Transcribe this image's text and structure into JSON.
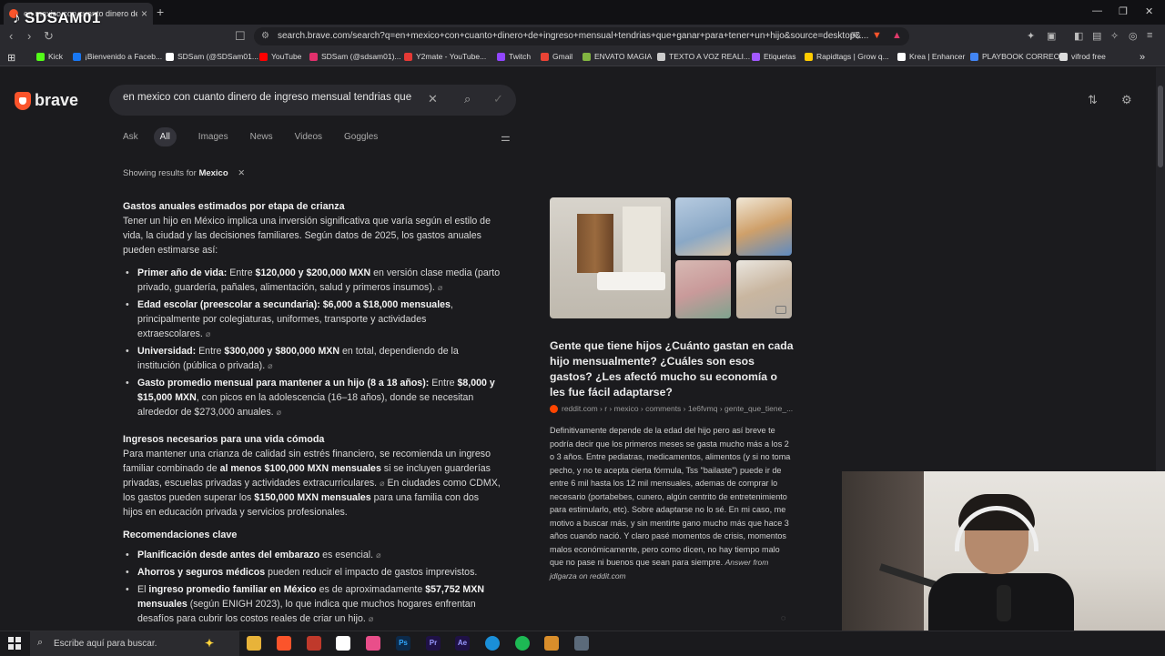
{
  "overlay": {
    "watermark": "SDSAM01"
  },
  "browser": {
    "tab_title": "en mexico con cuanto dinero de...",
    "url": "search.brave.com/search?q=en+mexico+con+cuanto+dinero+de+ingreso+mensual+tendrias+que+ganar+para+tener+un+hijo&source=desktop&...",
    "bookmarks": [
      {
        "label": "Kick",
        "color": "#53fc18"
      },
      {
        "label": "¡Bienvenido a Faceb...",
        "color": "#1877f2"
      },
      {
        "label": "SDSam (@SDSam01...",
        "color": "#ffffff"
      },
      {
        "label": "YouTube",
        "color": "#ff0000"
      },
      {
        "label": "SDSam (@sdsam01)...",
        "color": "#e1306c"
      },
      {
        "label": "Y2mate - YouTube...",
        "color": "#e53935"
      },
      {
        "label": "Twitch",
        "color": "#9146ff"
      },
      {
        "label": "Gmail",
        "color": "#ea4335"
      },
      {
        "label": "ENVATO MAGIA",
        "color": "#82b541"
      },
      {
        "label": "TEXTO A VOZ REALI...",
        "color": "#cccccc"
      },
      {
        "label": "Etiquetas",
        "color": "#a259ff"
      },
      {
        "label": "Rapidtags | Grow q...",
        "color": "#ffcc00"
      },
      {
        "label": "Krea | Enhancer",
        "color": "#ffffff"
      },
      {
        "label": "PLAYBOOK CORREO",
        "color": "#4285f4"
      },
      {
        "label": "vifrod free",
        "color": "#dddddd"
      }
    ]
  },
  "search": {
    "brand": "brave",
    "query": "en mexico con cuanto dinero de ingreso mensual tendrias que ganar para tener un hijo",
    "tabs": [
      "Ask",
      "All",
      "Images",
      "News",
      "Videos",
      "Goggles"
    ],
    "active_tab": "All",
    "showing_prefix": "Showing results for",
    "showing_region": "Mexico"
  },
  "answer": {
    "s1_title": "Gastos anuales estimados por etapa de crianza",
    "s1_intro": "Tener un hijo en México implica una inversión significativa que varía según el estilo de vida, la ciudad y las decisiones familiares. Según datos de 2025, los gastos anuales pueden estimarse así:",
    "s1_items": [
      {
        "bold": "Primer año de vida:",
        "pre": " Entre ",
        "amount": "$120,000 y $200,000 MXN",
        "rest": " en versión clase media (parto privado, guardería, pañales, alimentación, salud y primeros insumos)."
      },
      {
        "bold": "Edad escolar (preescolar a secundaria):",
        "pre": " ",
        "amount": "$6,000 a $18,000 mensuales",
        "rest": ", principalmente por colegiaturas, uniformes, transporte y actividades extraescolares."
      },
      {
        "bold": "Universidad:",
        "pre": " Entre ",
        "amount": "$300,000 y $800,000 MXN",
        "rest": " en total, dependiendo de la institución (pública o privada)."
      },
      {
        "bold": "Gasto promedio mensual para mantener a un hijo (8 a 18 años):",
        "pre": " Entre ",
        "amount": "$8,000 y $15,000 MXN",
        "rest": ", con picos en la adolescencia (16–18 años), donde se necesitan alrededor de $273,000 anuales."
      }
    ],
    "s2_title": "Ingresos necesarios para una vida cómoda",
    "s2_p1": "Para mantener una crianza de calidad sin estrés financiero, se recomienda un ingreso familiar combinado de ",
    "s2_b1": "al menos $100,000 MXN mensuales",
    "s2_p2": " si se incluyen guarderías privadas, escuelas privadas y actividades extracurriculares.",
    "s2_p3": " En ciudades como CDMX, los gastos pueden superar los ",
    "s2_b2": "$150,000 MXN mensuales",
    "s2_p4": " para una familia con dos hijos en educación privada y servicios profesionales.",
    "s3_title": "Recomendaciones clave",
    "s3_items": [
      {
        "bold": "Planificación desde antes del embarazo",
        "rest": " es esencial."
      },
      {
        "bold": "Ahorros y seguros médicos",
        "rest": " pueden reducir el impacto de gastos imprevistos."
      },
      {
        "pre": "El ",
        "bold": "ingreso promedio familiar en México",
        "mid": " es de aproximadamente ",
        "bold2": "$57,752 MXN mensuales",
        "rest": " (según ENIGH 2023), lo que indica que muchos hogares enfrentan desafíos para cubrir los costos reales de criar un hijo."
      }
    ]
  },
  "result": {
    "title": "Gente que tiene hijos ¿Cuánto gastan en cada hijo mensualmente? ¿Cuáles son esos gastos? ¿Les afectó mucho su economía o les fue fácil adaptarse?",
    "source": "reddit.com › r › mexico › comments › 1e6fvmq › gente_que_tiene_...",
    "body": "Definitivamente depende de la edad del hijo pero así breve te podría decir que los primeros meses se gasta mucho más a los 2 o 3 años. Entre pediatras, medicamentos, alimentos (y si no toma pecho, y no te acepta cierta fórmula, Tss \"bailaste\") puede ir de entre 6 mil hasta los 12 mil mensuales, ademas de comprar lo necesario (portabebes, cunero, algún centrito de entretenimiento para estimularlo, etc). Sobre adaptarse no lo sé. En mi caso, me motivo a buscar más, y sin mentirte gano mucho más que hace 3 años cuando nació. Y claro pasé momentos de crisis, momentos malos económicamente, pero como dicen, no hay tiempo malo que no pase ni buenos que sean para siempre.",
    "attribution": "Answer from jdlgarza on reddit.com"
  },
  "taskbar": {
    "search_placeholder": "Escribe aquí para buscar."
  }
}
